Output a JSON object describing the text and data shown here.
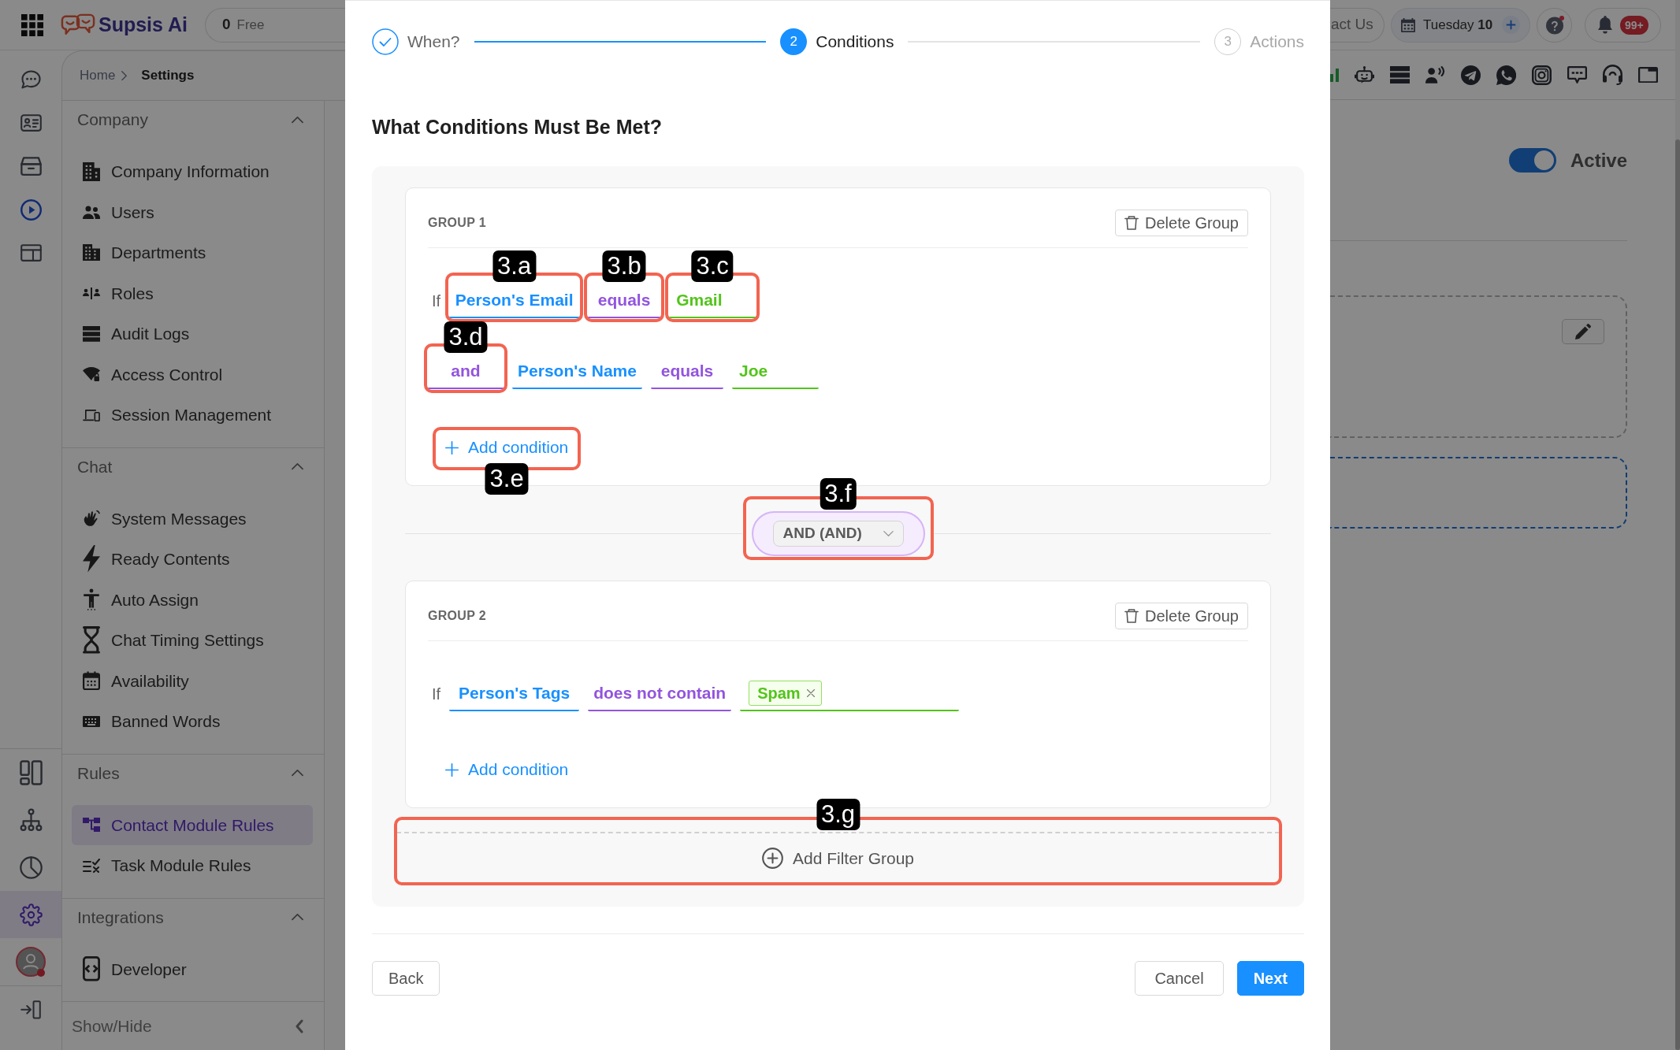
{
  "app": {
    "brand": "Supsis Ai",
    "plan": {
      "count": "0",
      "label": "Free"
    },
    "rail": {
      "top": [
        {
          "selected": false
        },
        {
          "selected": false
        },
        {
          "selected": false
        },
        {
          "selected": false
        },
        {
          "selected": false
        }
      ],
      "bottom": [
        {
          "selected": false
        },
        {
          "selected": false
        },
        {
          "selected": false
        },
        {
          "selected": true
        }
      ]
    },
    "breadcrumb": [
      "Home",
      "Settings"
    ],
    "nav": {
      "sections": [
        {
          "title": "Company",
          "expanded": true,
          "items": [
            {
              "label": "Company Information",
              "selected": false
            },
            {
              "label": "Users",
              "selected": false
            },
            {
              "label": "Departments",
              "selected": false
            },
            {
              "label": "Roles",
              "selected": false
            },
            {
              "label": "Audit Logs",
              "selected": false
            },
            {
              "label": "Access Control",
              "selected": false
            },
            {
              "label": "Session Management",
              "selected": false
            }
          ]
        },
        {
          "title": "Chat",
          "expanded": true,
          "items": [
            {
              "label": "System Messages",
              "selected": false
            },
            {
              "label": "Ready Contents",
              "selected": false
            },
            {
              "label": "Auto Assign",
              "selected": false
            },
            {
              "label": "Chat Timing Settings",
              "selected": false
            },
            {
              "label": "Availability",
              "selected": false
            },
            {
              "label": "Banned Words",
              "selected": false
            }
          ]
        },
        {
          "title": "Rules",
          "expanded": true,
          "items": [
            {
              "label": "Contact Module Rules",
              "selected": true
            },
            {
              "label": "Task Module Rules",
              "selected": false
            }
          ]
        },
        {
          "title": "Integrations",
          "expanded": true,
          "items": [
            {
              "label": "Developer",
              "selected": false
            }
          ]
        }
      ],
      "toggle_label": "Show/Hide"
    },
    "header": {
      "contact": "act Us",
      "date": "Tuesday **10**",
      "notifications": "99+"
    },
    "rule_status": {
      "label": "Active",
      "on": true
    }
  },
  "modal": {
    "steps": [
      {
        "label": "When?",
        "completed": true,
        "selected": false
      },
      {
        "number": "2",
        "label": "Conditions",
        "completed": false,
        "selected": true
      },
      {
        "number": "3",
        "label": "Actions",
        "completed": false,
        "selected": false
      }
    ],
    "title": "What Conditions Must Be Met?",
    "groups": [
      {
        "title": "GROUP 1",
        "delete": "Delete Group",
        "conditions": [
          {
            "connector": {
              "kind": "text",
              "text": "If"
            },
            "field": {
              "text": "Person's Email",
              "callout": "3.a"
            },
            "operator": {
              "text": "equals",
              "callout": "3.b"
            },
            "value": {
              "kind": "text",
              "text": "Gmail",
              "callout": "3.c"
            }
          },
          {
            "connector": {
              "kind": "select",
              "text": "and",
              "callout": "3.d"
            },
            "field": {
              "text": "Person's Name"
            },
            "operator": {
              "text": "equals"
            },
            "value": {
              "kind": "text",
              "text": "Joe"
            }
          }
        ],
        "add_condition": {
          "label": "Add condition",
          "callout": "3.e"
        }
      },
      {
        "joiner": {
          "text": "AND (AND)",
          "callout": "3.f"
        },
        "title": "GROUP 2",
        "delete": "Delete Group",
        "conditions": [
          {
            "connector": {
              "kind": "text",
              "text": "If"
            },
            "field": {
              "text": "Person's Tags"
            },
            "operator": {
              "text": "does not contain"
            },
            "value": {
              "kind": "tags",
              "tags": [
                "Spam"
              ]
            }
          }
        ],
        "add_condition": {
          "label": "Add condition"
        }
      }
    ],
    "add_group": {
      "label": "Add Filter Group",
      "callout": "3.g"
    },
    "footer": {
      "back": "Back",
      "cancel": "Cancel",
      "next": "Next"
    }
  }
}
